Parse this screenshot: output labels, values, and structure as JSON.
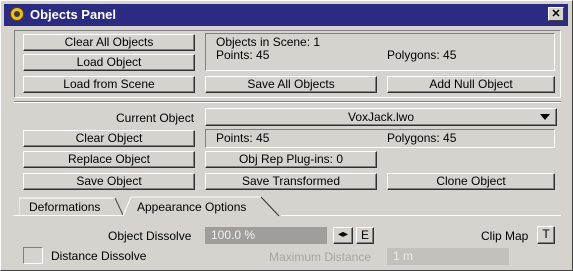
{
  "window": {
    "title": "Objects Panel",
    "close_label": "✕"
  },
  "top": {
    "clear_all_label": "Clear All Objects",
    "load_object_label": "Load Object",
    "load_from_scene_label": "Load from Scene",
    "save_all_label": "Save All Objects",
    "add_null_label": "Add Null Object",
    "scene_info": {
      "objects_in_scene": "Objects in Scene: 1",
      "points": "Points: 45",
      "polygons": "Polygons: 45"
    }
  },
  "current": {
    "label": "Current Object",
    "value": "VoxJack.lwo",
    "clear_label": "Clear Object",
    "points": "Points: 45",
    "polygons": "Polygons: 45",
    "replace_label": "Replace Object",
    "obj_rep_label": "Obj Rep Plug-ins: 0",
    "save_label": "Save Object",
    "save_transformed_label": "Save Transformed",
    "clone_label": "Clone Object"
  },
  "tabs": [
    {
      "label": "Deformations",
      "active": false
    },
    {
      "label": "Appearance Options",
      "active": true
    }
  ],
  "appearance": {
    "dissolve_label": "Object Dissolve",
    "dissolve_value": "100.0 %",
    "envelope_arrows": "◂▸",
    "envelope_label": "E",
    "clip_map_label": "Clip Map",
    "clip_map_button": "T",
    "distance_dissolve_label": "Distance Dissolve",
    "distance_dissolve_checked": false,
    "max_distance_label": "Maximum Distance",
    "max_distance_value": "1 m"
  }
}
